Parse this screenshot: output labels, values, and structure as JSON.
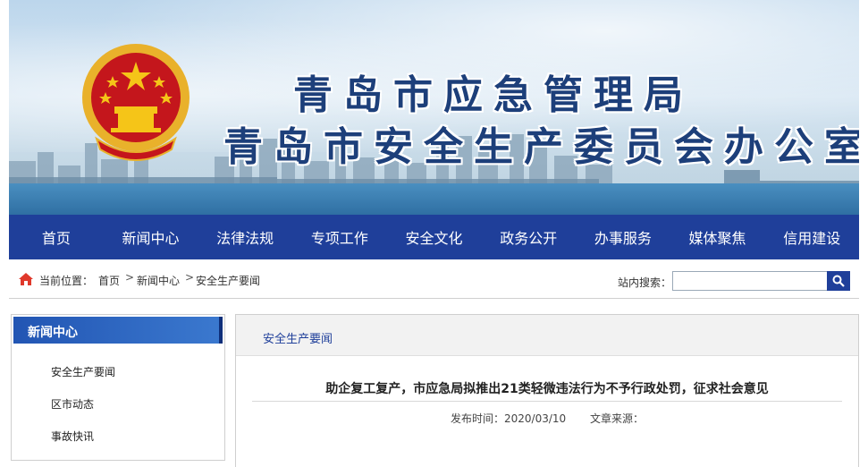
{
  "banner": {
    "title_line1": "青岛市应急管理局",
    "title_line2": "青岛市安全生产委员会办公室"
  },
  "nav": {
    "items": [
      "首页",
      "新闻中心",
      "法律法规",
      "专项工作",
      "安全文化",
      "政务公开",
      "办事服务",
      "媒体聚焦",
      "信用建设"
    ]
  },
  "breadcrumb": {
    "label": "当前位置：",
    "items": [
      "首页",
      "新闻中心",
      "安全生产要闻"
    ],
    "separator": ">"
  },
  "search": {
    "label": "站内搜索：",
    "value": "",
    "placeholder": ""
  },
  "sidebar": {
    "title": "新闻中心",
    "items": [
      "安全生产要闻",
      "区市动态",
      "事故快讯"
    ]
  },
  "main": {
    "tab": "安全生产要闻",
    "article_title": "助企复工复产，市应急局拟推出21类轻微违法行为不予行政处罚，征求社会意见",
    "date_label": "发布时间：",
    "date": "2020/03/10",
    "source_label": "文章来源："
  },
  "colors": {
    "nav_bg": "#1f3f9a",
    "title_text": "#1d3f7a",
    "emblem_red": "#c4161c",
    "emblem_gold": "#e9b12b"
  }
}
